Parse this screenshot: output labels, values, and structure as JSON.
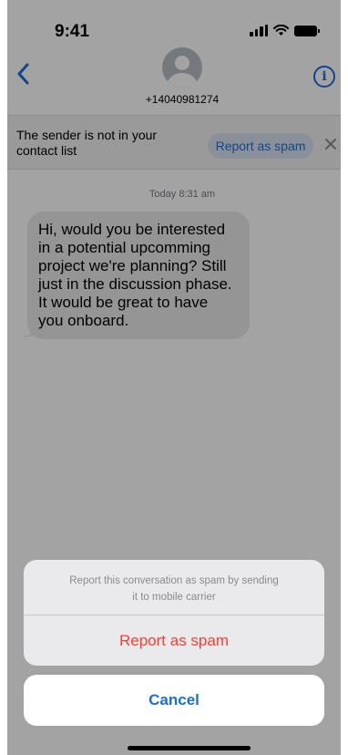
{
  "status_bar": {
    "time": "9:41"
  },
  "nav": {
    "phone_number": "+14040981274"
  },
  "banner": {
    "text": "The sender is not in your contact list",
    "report_label": "Report as spam"
  },
  "thread": {
    "timestamp": "Today 8:31 am",
    "message": "Hi, would you be interested in a potential upcomming project we're planning? Still just in the discussion phase. It would be great to have you onboard."
  },
  "sheet": {
    "message": "Report this conversation as spam by sending it to mobile carrier",
    "action_label": "Report as spam",
    "cancel_label": "Cancel"
  },
  "colors": {
    "accent": "#1a6fd8",
    "destructive": "#ff3b30"
  },
  "icons": [
    "back-chevron-icon",
    "avatar-icon",
    "info-icon",
    "close-icon",
    "signal-icon",
    "wifi-icon",
    "battery-icon"
  ]
}
